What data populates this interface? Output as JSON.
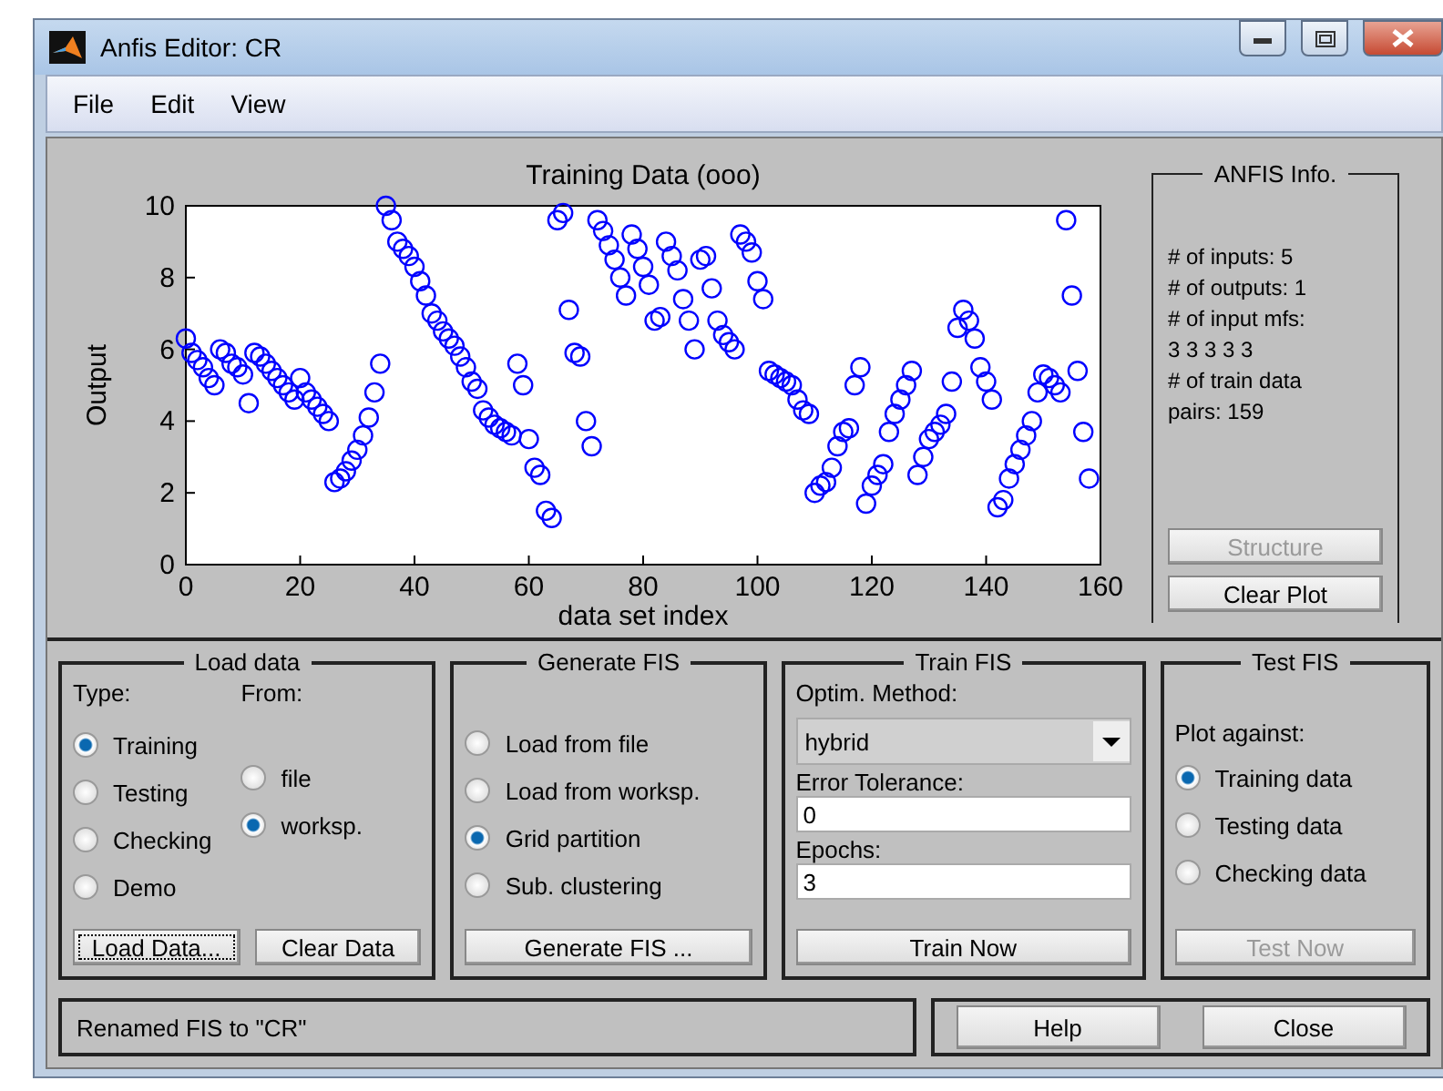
{
  "window": {
    "title": "Anfis Editor: CR"
  },
  "menu": [
    {
      "label": "File"
    },
    {
      "label": "Edit"
    },
    {
      "label": "View"
    }
  ],
  "plot": {
    "chart_data": {
      "type": "scatter",
      "title": "Training Data (ooo)",
      "xlabel": "data set index",
      "ylabel": "Output",
      "xlim": [
        0,
        160
      ],
      "ylim": [
        0,
        10
      ],
      "xticks": [
        0,
        20,
        40,
        60,
        80,
        100,
        120,
        140,
        160
      ],
      "yticks": [
        0,
        2,
        4,
        6,
        8,
        10
      ],
      "x": [
        0,
        1,
        2,
        3,
        4,
        5,
        6,
        7,
        8,
        9,
        10,
        11,
        12,
        13,
        14,
        15,
        16,
        17,
        18,
        19,
        20,
        21,
        22,
        23,
        24,
        25,
        26,
        27,
        28,
        29,
        30,
        31,
        32,
        33,
        34,
        35,
        36,
        37,
        38,
        39,
        40,
        41,
        42,
        43,
        44,
        45,
        46,
        47,
        48,
        49,
        50,
        51,
        52,
        53,
        54,
        55,
        56,
        57,
        58,
        59,
        60,
        61,
        62,
        63,
        64,
        65,
        66,
        67,
        68,
        69,
        70,
        71,
        72,
        73,
        74,
        75,
        76,
        77,
        78,
        79,
        80,
        81,
        82,
        83,
        84,
        85,
        86,
        87,
        88,
        89,
        90,
        91,
        92,
        93,
        94,
        95,
        96,
        97,
        98,
        99,
        100,
        101,
        102,
        103,
        104,
        105,
        106,
        107,
        108,
        109,
        110,
        111,
        112,
        113,
        114,
        115,
        116,
        117,
        118,
        119,
        120,
        121,
        122,
        123,
        124,
        125,
        126,
        127,
        128,
        129,
        130,
        131,
        132,
        133,
        134,
        135,
        136,
        137,
        138,
        139,
        140,
        141,
        142,
        143,
        144,
        145,
        146,
        147,
        148,
        149,
        150,
        151,
        152,
        153,
        154,
        155,
        156,
        157,
        158
      ],
      "series": [
        {
          "color": "#0000ff",
          "values": [
            6.3,
            5.9,
            5.7,
            5.5,
            5.2,
            5.0,
            6.0,
            5.9,
            5.6,
            5.5,
            5.3,
            4.5,
            5.9,
            5.8,
            5.6,
            5.4,
            5.2,
            5.0,
            4.8,
            4.6,
            5.2,
            4.8,
            4.6,
            4.4,
            4.2,
            4.0,
            2.3,
            2.4,
            2.6,
            2.9,
            3.2,
            3.6,
            4.1,
            4.8,
            5.6,
            10.0,
            9.6,
            9.0,
            8.8,
            8.6,
            8.3,
            7.9,
            7.5,
            7.0,
            6.8,
            6.5,
            6.3,
            6.1,
            5.8,
            5.5,
            5.1,
            4.9,
            4.3,
            4.1,
            3.9,
            3.8,
            3.7,
            3.6,
            5.6,
            5.0,
            3.5,
            2.7,
            2.5,
            1.5,
            1.3,
            9.6,
            9.8,
            7.1,
            5.9,
            5.8,
            4.0,
            3.3,
            9.6,
            9.3,
            8.9,
            8.5,
            8.0,
            7.5,
            9.2,
            8.8,
            8.3,
            7.8,
            6.8,
            6.9,
            9.0,
            8.6,
            8.2,
            7.4,
            6.8,
            6.0,
            8.5,
            8.6,
            7.7,
            6.8,
            6.4,
            6.2,
            6.0,
            9.2,
            9.0,
            8.7,
            7.9,
            7.4,
            5.4,
            5.3,
            5.2,
            5.1,
            5.0,
            4.6,
            4.3,
            4.2,
            2.0,
            2.2,
            2.3,
            2.7,
            3.3,
            3.7,
            3.8,
            5.0,
            5.5,
            1.7,
            2.2,
            2.5,
            2.8,
            3.7,
            4.2,
            4.6,
            5.0,
            5.4,
            2.5,
            3.0,
            3.5,
            3.7,
            3.9,
            4.2,
            5.1,
            6.6,
            7.1,
            6.8,
            6.3,
            5.5,
            5.1,
            4.6,
            1.6,
            1.8,
            2.4,
            2.8,
            3.2,
            3.6,
            4.0,
            4.8,
            5.3,
            5.2,
            5.0,
            4.8,
            9.6,
            7.5,
            5.4,
            3.7,
            2.4
          ]
        }
      ]
    }
  },
  "info": {
    "title": "ANFIS Info.",
    "lines": [
      "# of inputs: 5",
      "# of outputs: 1",
      "# of input mfs:",
      "3 3 3 3 3",
      "# of train data",
      "pairs: 159"
    ],
    "buttons": [
      {
        "label": "Structure",
        "disabled": true
      },
      {
        "label": "Clear Plot",
        "disabled": false
      }
    ]
  },
  "load_data": {
    "title": "Load data",
    "type_label": "Type:",
    "from_label": "From:",
    "type_options": [
      {
        "label": "Training",
        "selected": true
      },
      {
        "label": "Testing",
        "selected": false
      },
      {
        "label": "Checking",
        "selected": false
      },
      {
        "label": "Demo",
        "selected": false
      }
    ],
    "from_options": [
      {
        "label": "file",
        "selected": false
      },
      {
        "label": "worksp.",
        "selected": true
      }
    ],
    "buttons": [
      {
        "label": "Load Data...",
        "focused": true
      },
      {
        "label": "Clear Data",
        "focused": false
      }
    ]
  },
  "generate_fis": {
    "title": "Generate FIS",
    "options": [
      {
        "label": "Load from file",
        "selected": false
      },
      {
        "label": "Load from worksp.",
        "selected": false
      },
      {
        "label": "Grid partition",
        "selected": true
      },
      {
        "label": "Sub. clustering",
        "selected": false
      }
    ],
    "button": {
      "label": "Generate FIS ..."
    }
  },
  "train_fis": {
    "title": "Train FIS",
    "method_label": "Optim. Method:",
    "method_value": "hybrid",
    "tolerance_label": "Error Tolerance:",
    "tolerance_value": "0",
    "epochs_label": "Epochs:",
    "epochs_value": "3",
    "button": {
      "label": "Train Now"
    }
  },
  "test_fis": {
    "title": "Test FIS",
    "plot_against_label": "Plot against:",
    "options": [
      {
        "label": "Training data",
        "selected": true
      },
      {
        "label": "Testing data",
        "selected": false
      },
      {
        "label": "Checking data",
        "selected": false
      }
    ],
    "button": {
      "label": "Test Now",
      "disabled": true
    }
  },
  "status": "Renamed FIS to \"CR\"",
  "footer_buttons": [
    {
      "label": "Help"
    },
    {
      "label": "Close"
    }
  ]
}
